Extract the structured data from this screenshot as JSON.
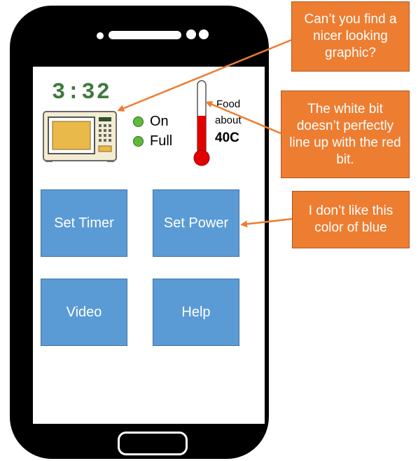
{
  "screen": {
    "timer": "3:32",
    "indicators": [
      {
        "label": "On",
        "color": "#5fba3a"
      },
      {
        "label": "Full",
        "color": "#5fba3a"
      }
    ],
    "thermometer": {
      "label_line1": "Food",
      "label_line2": "about",
      "temperature": "40C",
      "fill_fraction": 0.55
    },
    "buttons": [
      {
        "label": "Set Timer"
      },
      {
        "label": "Set Power"
      },
      {
        "label": "Video"
      },
      {
        "label": "Help"
      }
    ]
  },
  "callouts": [
    {
      "text": "Can’t you find a nicer looking graphic?"
    },
    {
      "text": "The white bit doesn’t perfectly line up with the red bit."
    },
    {
      "text": "I don’t like this color of blue"
    }
  ],
  "colors": {
    "button_blue": "#5b9bd5",
    "callout_orange": "#ed7d31",
    "timer_green": "#3f7a3f",
    "thermometer_red": "#e00000"
  }
}
